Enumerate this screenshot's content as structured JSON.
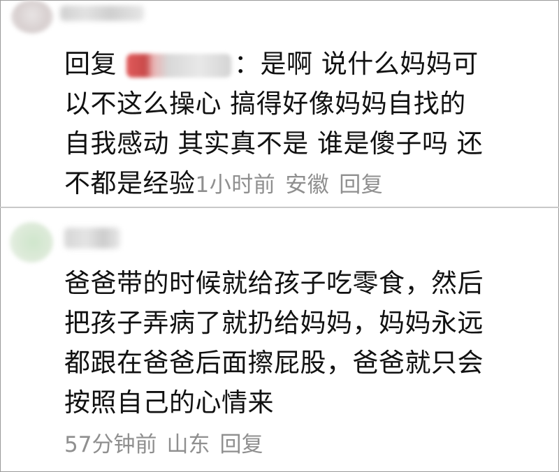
{
  "comments": [
    {
      "reply_prefix": "回复",
      "separator": "：",
      "lines": [
        "是啊 说什么妈妈可",
        "以不这么操心 搞得好像妈妈自找的",
        "自我感动 其实真不是 谁是傻子吗 还",
        "不都是经验"
      ],
      "time": "1小时前",
      "location": "安徽",
      "reply_label": "回复"
    },
    {
      "lines": [
        "爸爸带的时候就给孩子吃零食，然后",
        "把孩子弄病了就扔给妈妈，妈妈永远",
        "都跟在爸爸后面擦屁股，爸爸就只会",
        "按照自己的心情来"
      ],
      "time": "57分钟前",
      "location": "山东",
      "reply_label": "回复"
    }
  ]
}
